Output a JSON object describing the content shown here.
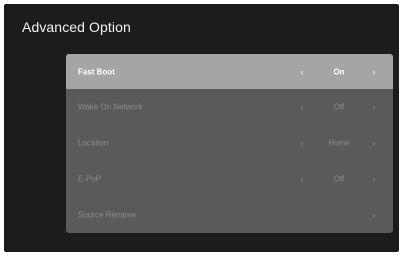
{
  "title": "Advanced Option",
  "menu": {
    "items": [
      {
        "label": "Fast Boot",
        "value": "On",
        "selected": true
      },
      {
        "label": "Wake On Network",
        "value": "Off",
        "selected": false
      },
      {
        "label": "Location",
        "value": "Home",
        "selected": false
      },
      {
        "label": "E-PoP",
        "value": "Off",
        "selected": false
      },
      {
        "label": "Source Rename",
        "value": "",
        "selected": false
      }
    ],
    "left_icon": "‹",
    "right_icon": "›"
  },
  "colors": {
    "background": "#1c1c1c",
    "panel": "#5a5a5a",
    "selected_row": "#a5a5a5",
    "title_text": "#f2f2f2"
  }
}
